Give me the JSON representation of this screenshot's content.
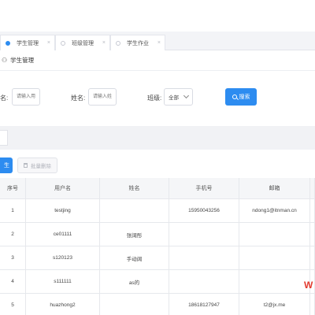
{
  "tabs": [
    {
      "label": "学生管理",
      "close": "×",
      "active": true
    },
    {
      "label": "班级管理",
      "close": "×",
      "active": false
    },
    {
      "label": "学生作业",
      "close": "×",
      "active": false
    }
  ],
  "section": {
    "icon": "people-icon",
    "title": "学生管理"
  },
  "filter": {
    "username_label": "名:",
    "username_placeholder": "请输入用",
    "name_label": "姓名:",
    "name_placeholder": "请输入姓",
    "class_label": "班级:",
    "class_value": "全部",
    "search_label": "搜索"
  },
  "toolbar": {
    "add_label": "生",
    "batch_delete_label": "批量删除"
  },
  "table": {
    "columns": [
      "序号",
      "用户名",
      "姓名",
      "",
      "手机号",
      "邮箱"
    ],
    "rows": [
      [
        "1",
        "testjing",
        "",
        "",
        "15950043256",
        "ndong1@itnman.cn"
      ],
      [
        "2",
        "ce01111",
        "张阔彤",
        "",
        "",
        ""
      ],
      [
        "3",
        "s120123",
        "手动阔",
        "",
        "",
        ""
      ],
      [
        "4",
        "s111111",
        "as的",
        "",
        "",
        ""
      ],
      [
        "5",
        "huazhong2",
        "",
        "",
        "18618127947",
        "t2@jx.me"
      ]
    ]
  },
  "watermark": "W",
  "colors": {
    "accent": "#2d8cf0",
    "watermark": "#e23a2e"
  }
}
